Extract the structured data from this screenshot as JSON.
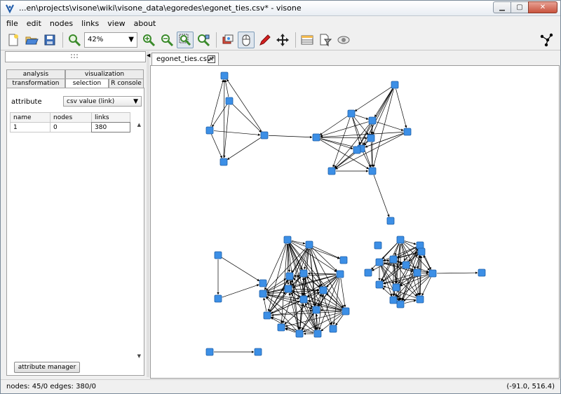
{
  "window": {
    "title": "...en\\projects\\visone\\wiki\\visone_data\\egoredes\\egonet_ties.csv* - visone"
  },
  "menu": [
    "file",
    "edit",
    "nodes",
    "links",
    "view",
    "about"
  ],
  "toolbar": {
    "zoom_value": "42%"
  },
  "left_panel": {
    "tabs_row1": [
      "analysis",
      "visualization"
    ],
    "tabs_row2": [
      "transformation",
      "selection",
      "R console"
    ],
    "active_tab": "selection",
    "attribute_label": "attribute",
    "attribute_value": "csv value (link)",
    "table": {
      "headers": [
        "name",
        "nodes",
        "links"
      ],
      "rows": [
        [
          "1",
          "0",
          "380"
        ]
      ]
    },
    "attribute_manager_label": "attribute manager"
  },
  "document": {
    "tab_label": "egonet_ties.csv*"
  },
  "status": {
    "left": "nodes: 45/0  edges: 380/0",
    "right": "(-91.0, 516.4)"
  },
  "colors": {
    "node": "#3c8fe6",
    "edge": "#000000"
  }
}
